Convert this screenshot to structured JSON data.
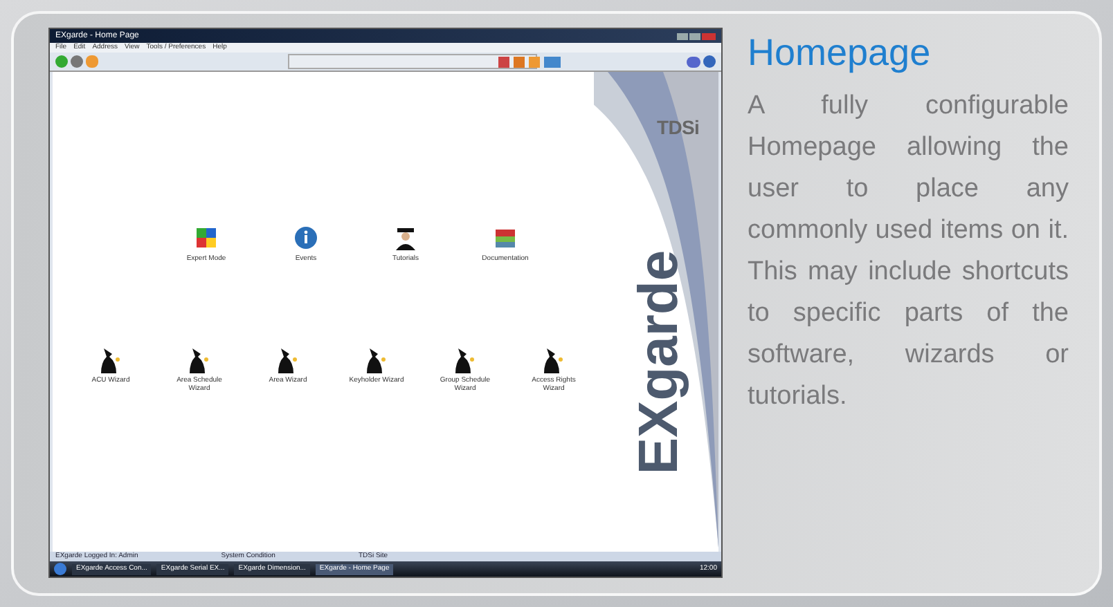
{
  "screenshot": {
    "window_title": "EXgarde - Home Page",
    "menu": [
      "File",
      "Edit",
      "Address",
      "View",
      "Tools / Preferences",
      "Help"
    ],
    "logo": "TDSi",
    "brand": "EXgarde",
    "shortcuts": [
      {
        "kind": "cube",
        "label": "Expert Mode"
      },
      {
        "kind": "info",
        "label": "Events"
      },
      {
        "kind": "graduate",
        "label": "Tutorials"
      },
      {
        "kind": "books",
        "label": "Documentation"
      }
    ],
    "wizards": [
      {
        "label": "ACU Wizard"
      },
      {
        "label": "Area Schedule Wizard"
      },
      {
        "label": "Area Wizard"
      },
      {
        "label": "Keyholder Wizard"
      },
      {
        "label": "Group Schedule Wizard"
      },
      {
        "label": "Access Rights Wizard"
      }
    ],
    "status_bar": [
      "EXgarde Logged In: Admin",
      "System Condition",
      "TDSi Site"
    ],
    "taskbar": [
      "EXgarde Access Con...",
      "EXgarde Serial EX...",
      "EXgarde Dimension...",
      "EXgarde - Home Page"
    ],
    "clock": "12:00"
  },
  "heading": "Homepage",
  "description": "A fully configurable Homepage allowing the user to place any commonly used items on it. This may include shortcuts to specific parts of the software, wizards or tutorials."
}
